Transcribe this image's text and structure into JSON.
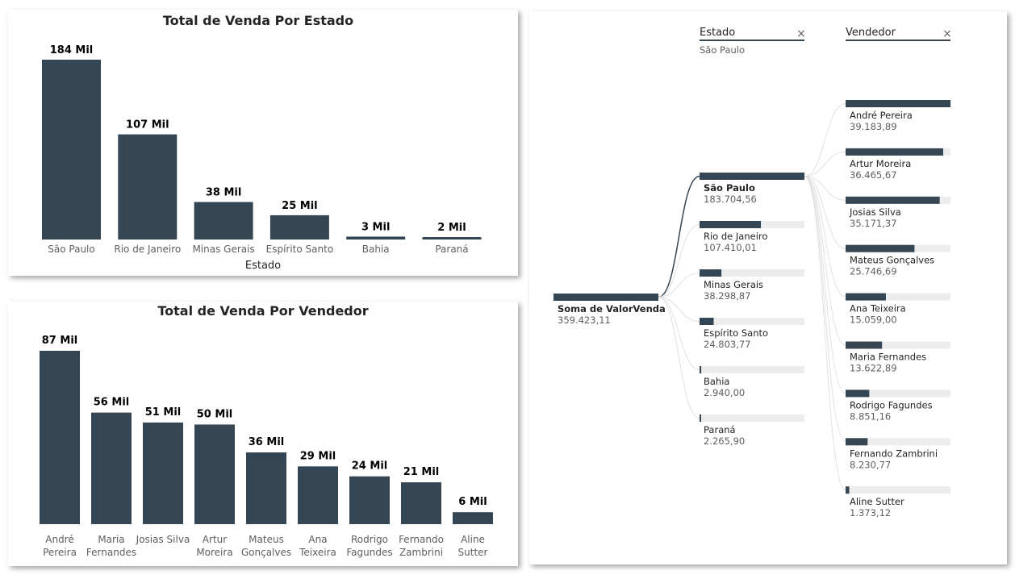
{
  "colors": {
    "bar": "#344654",
    "track": "#ececec",
    "connector": "#e1e1e1",
    "active_connector": "#344654"
  },
  "chart_data": [
    {
      "type": "bar",
      "title": "Total de Venda Por Estado",
      "xlabel": "Estado",
      "ylabel": "",
      "categories": [
        "São Paulo",
        "Rio de Janeiro",
        "Minas Gerais",
        "Espírito Santo",
        "Bahia",
        "Paraná"
      ],
      "values": [
        183704.56,
        107410.01,
        38298.87,
        24803.77,
        2940.0,
        2265.9
      ],
      "data_labels": [
        "184 Mil",
        "107 Mil",
        "38 Mil",
        "25 Mil",
        "3 Mil",
        "2 Mil"
      ]
    },
    {
      "type": "bar",
      "title": "Total de Venda Por Vendedor",
      "xlabel": "",
      "ylabel": "",
      "categories": [
        "André Pereira",
        "Maria Fernandes",
        "Josias Silva",
        "Artur Moreira",
        "Mateus Gonçalves",
        "Ana Teixeira",
        "Rodrigo Fagundes",
        "Fernando Zambrini",
        "Aline Sutter"
      ],
      "category_lines": [
        [
          "André",
          "Pereira"
        ],
        [
          "Maria",
          "Fernandes"
        ],
        [
          "Josias Silva"
        ],
        [
          "Artur",
          "Moreira"
        ],
        [
          "Mateus",
          "Gonçalves"
        ],
        [
          "Ana",
          "Teixeira"
        ],
        [
          "Rodrigo",
          "Fagundes"
        ],
        [
          "Fernando",
          "Zambrini"
        ],
        [
          "Aline",
          "Sutter"
        ]
      ],
      "values": [
        87000,
        56000,
        51000,
        50000,
        36000,
        29000,
        24000,
        21000,
        6000
      ],
      "data_labels": [
        "87 Mil",
        "56 Mil",
        "51 Mil",
        "50 Mil",
        "36 Mil",
        "29 Mil",
        "24 Mil",
        "21 Mil",
        "6 Mil"
      ]
    }
  ],
  "decomposition_tree": {
    "root": {
      "label": "Soma de ValorVenda",
      "value": 359423.11,
      "value_text": "359.423,11"
    },
    "levels": [
      {
        "header": "Estado",
        "selection": "São Paulo",
        "clear_icon": "close-icon"
      },
      {
        "header": "Vendedor",
        "selection": "",
        "clear_icon": "close-icon"
      }
    ],
    "estado_nodes": [
      {
        "label": "São Paulo",
        "value": 183704.56,
        "value_text": "183.704,56",
        "selected": true
      },
      {
        "label": "Rio de Janeiro",
        "value": 107410.01,
        "value_text": "107.410,01",
        "selected": false
      },
      {
        "label": "Minas Gerais",
        "value": 38298.87,
        "value_text": "38.298,87",
        "selected": false
      },
      {
        "label": "Espírito Santo",
        "value": 24803.77,
        "value_text": "24.803,77",
        "selected": false
      },
      {
        "label": "Bahia",
        "value": 2940.0,
        "value_text": "2.940,00",
        "selected": false
      },
      {
        "label": "Paraná",
        "value": 2265.9,
        "value_text": "2.265,90",
        "selected": false
      }
    ],
    "vendedor_nodes": [
      {
        "label": "André Pereira",
        "value": 39183.89,
        "value_text": "39.183,89"
      },
      {
        "label": "Artur Moreira",
        "value": 36465.67,
        "value_text": "36.465,67"
      },
      {
        "label": "Josias Silva",
        "value": 35171.37,
        "value_text": "35.171,37"
      },
      {
        "label": "Mateus Gonçalves",
        "value": 25746.69,
        "value_text": "25.746,69"
      },
      {
        "label": "Ana Teixeira",
        "value": 15059.0,
        "value_text": "15.059,00"
      },
      {
        "label": "Maria Fernandes",
        "value": 13622.89,
        "value_text": "13.622,89"
      },
      {
        "label": "Rodrigo Fagundes",
        "value": 8851.16,
        "value_text": "8.851,16"
      },
      {
        "label": "Fernando Zambrini",
        "value": 8230.77,
        "value_text": "8.230,77"
      },
      {
        "label": "Aline Sutter",
        "value": 1373.12,
        "value_text": "1.373,12"
      }
    ]
  }
}
